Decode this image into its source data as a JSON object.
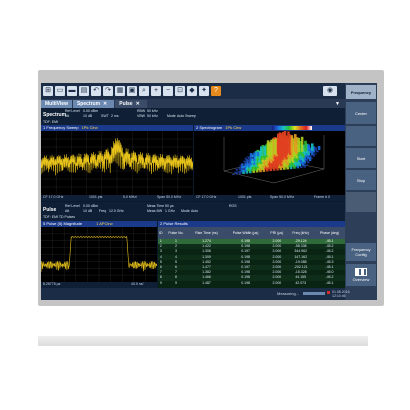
{
  "toolbar": {
    "icons": [
      "windows-icon",
      "open-icon",
      "save-icon",
      "print-icon",
      "undo-icon",
      "redo-icon",
      "grid-icon",
      "display-icon",
      "zoom-icon",
      "zoom-in-icon",
      "zoom-out-icon",
      "multi-zoom-icon",
      "marker-icon",
      "wizard-icon",
      "help-icon"
    ],
    "camera": "camera-icon"
  },
  "softkeys": {
    "header": "Frequency",
    "keys": [
      "Center",
      "",
      "Start",
      "Stop",
      "",
      "Frequency Config",
      "Overview"
    ]
  },
  "tabs": [
    {
      "label": "MultiView",
      "active": true
    },
    {
      "label": "Spectrum",
      "active": true
    },
    {
      "label": "Pulse",
      "active": false
    }
  ],
  "spectrum_header": {
    "name": "Spectrum",
    "ref_level_label": "Ref Level",
    "ref_level": "0.00 dBm",
    "att_label": "Att",
    "att": "10 dB",
    "swt_label": "SWT",
    "swt": "2 ms",
    "rbw_label": "RBW",
    "rbw": "50 kHz",
    "vbw_label": "VBW",
    "vbw": "50 kHz",
    "mode_label": "Mode",
    "mode": "Auto Sweep",
    "tdf": "TDF: EMI"
  },
  "frequency_sweep": {
    "title": "1 Frequency Sweep",
    "tag": "1Pk Clrw",
    "cf": "CF 17.0 GHz",
    "pts": "1001 pts",
    "span_per_div": "5.0 MHz/",
    "span": "Span 50.0 MHz"
  },
  "spectrogram": {
    "title": "2 Spectrogram",
    "tag": "1Pk Clrw",
    "cf": "CF 17.0 GHz",
    "pts": "1001 pts",
    "span": "Span 50.0 MHz",
    "frame": "Frame # 0"
  },
  "pulse_header": {
    "name": "Pulse",
    "ref_level_label": "Ref Level",
    "ref_level": "0.00 dBm",
    "att_label": "Att",
    "att": "10 dB",
    "freq_label": "Freq",
    "freq": "12.0 GHz",
    "meas_time_label": "Meas Time",
    "meas_time": "50 µs",
    "meas_bw_label": "Meas BW",
    "meas_bw": "1 GHz",
    "mode_label": "Mode",
    "mode": "Auto",
    "tdf": "TDF: EMI TD Pulses",
    "ros": "ROS"
  },
  "pulse_magnitude": {
    "title": "5 Pulse (5) Magnitude",
    "tag": "1 APClrw",
    "start": "8.25775 µs",
    "per_div": "40.0 ns/"
  },
  "pulse_results": {
    "title": "2 Pulse Results",
    "columns": [
      "ID",
      "Pulse No.",
      "Rise Time (ns)",
      "Pulse Width (µs)",
      "PRI (µs)",
      "Freq (kHz)",
      "Phase (deg)"
    ],
    "rows": [
      [
        "1",
        "1",
        "1.274",
        "0.198",
        "2.000",
        "-29.124",
        "-45.1"
      ],
      [
        "2",
        "2",
        "1.422",
        "0.198",
        "2.000",
        "-58.338",
        "-45.2"
      ],
      [
        "3",
        "3",
        "1.306",
        "0.197",
        "2.000",
        "344.962",
        "-45.2"
      ],
      [
        "4",
        "4",
        "1.309",
        "0.198",
        "2.000",
        "147.162",
        "-45.1"
      ],
      [
        "5",
        "5",
        "1.452",
        "0.198",
        "2.000",
        "-19.088",
        "-45.3"
      ],
      [
        "6",
        "6",
        "1.477",
        "0.197",
        "2.000",
        "-202.121",
        "-45.1"
      ],
      [
        "7",
        "7",
        "1.382",
        "0.198",
        "2.000",
        "-15.328",
        "-45.0"
      ],
      [
        "8",
        "8",
        "1.466",
        "0.198",
        "2.000",
        "44.155",
        "-45.2"
      ],
      [
        "9",
        "9",
        "1.487",
        "0.198",
        "2.000",
        "42.073",
        "-45.1"
      ]
    ]
  },
  "status": {
    "measuring": "Measuring...",
    "date": "01.08.2016",
    "time": "12:10:46"
  },
  "colors": {
    "trace": "#e6c21a",
    "window_title": "#1b3b8a",
    "selected_row": "#2f6a3a",
    "softkey": "#4a6282"
  }
}
